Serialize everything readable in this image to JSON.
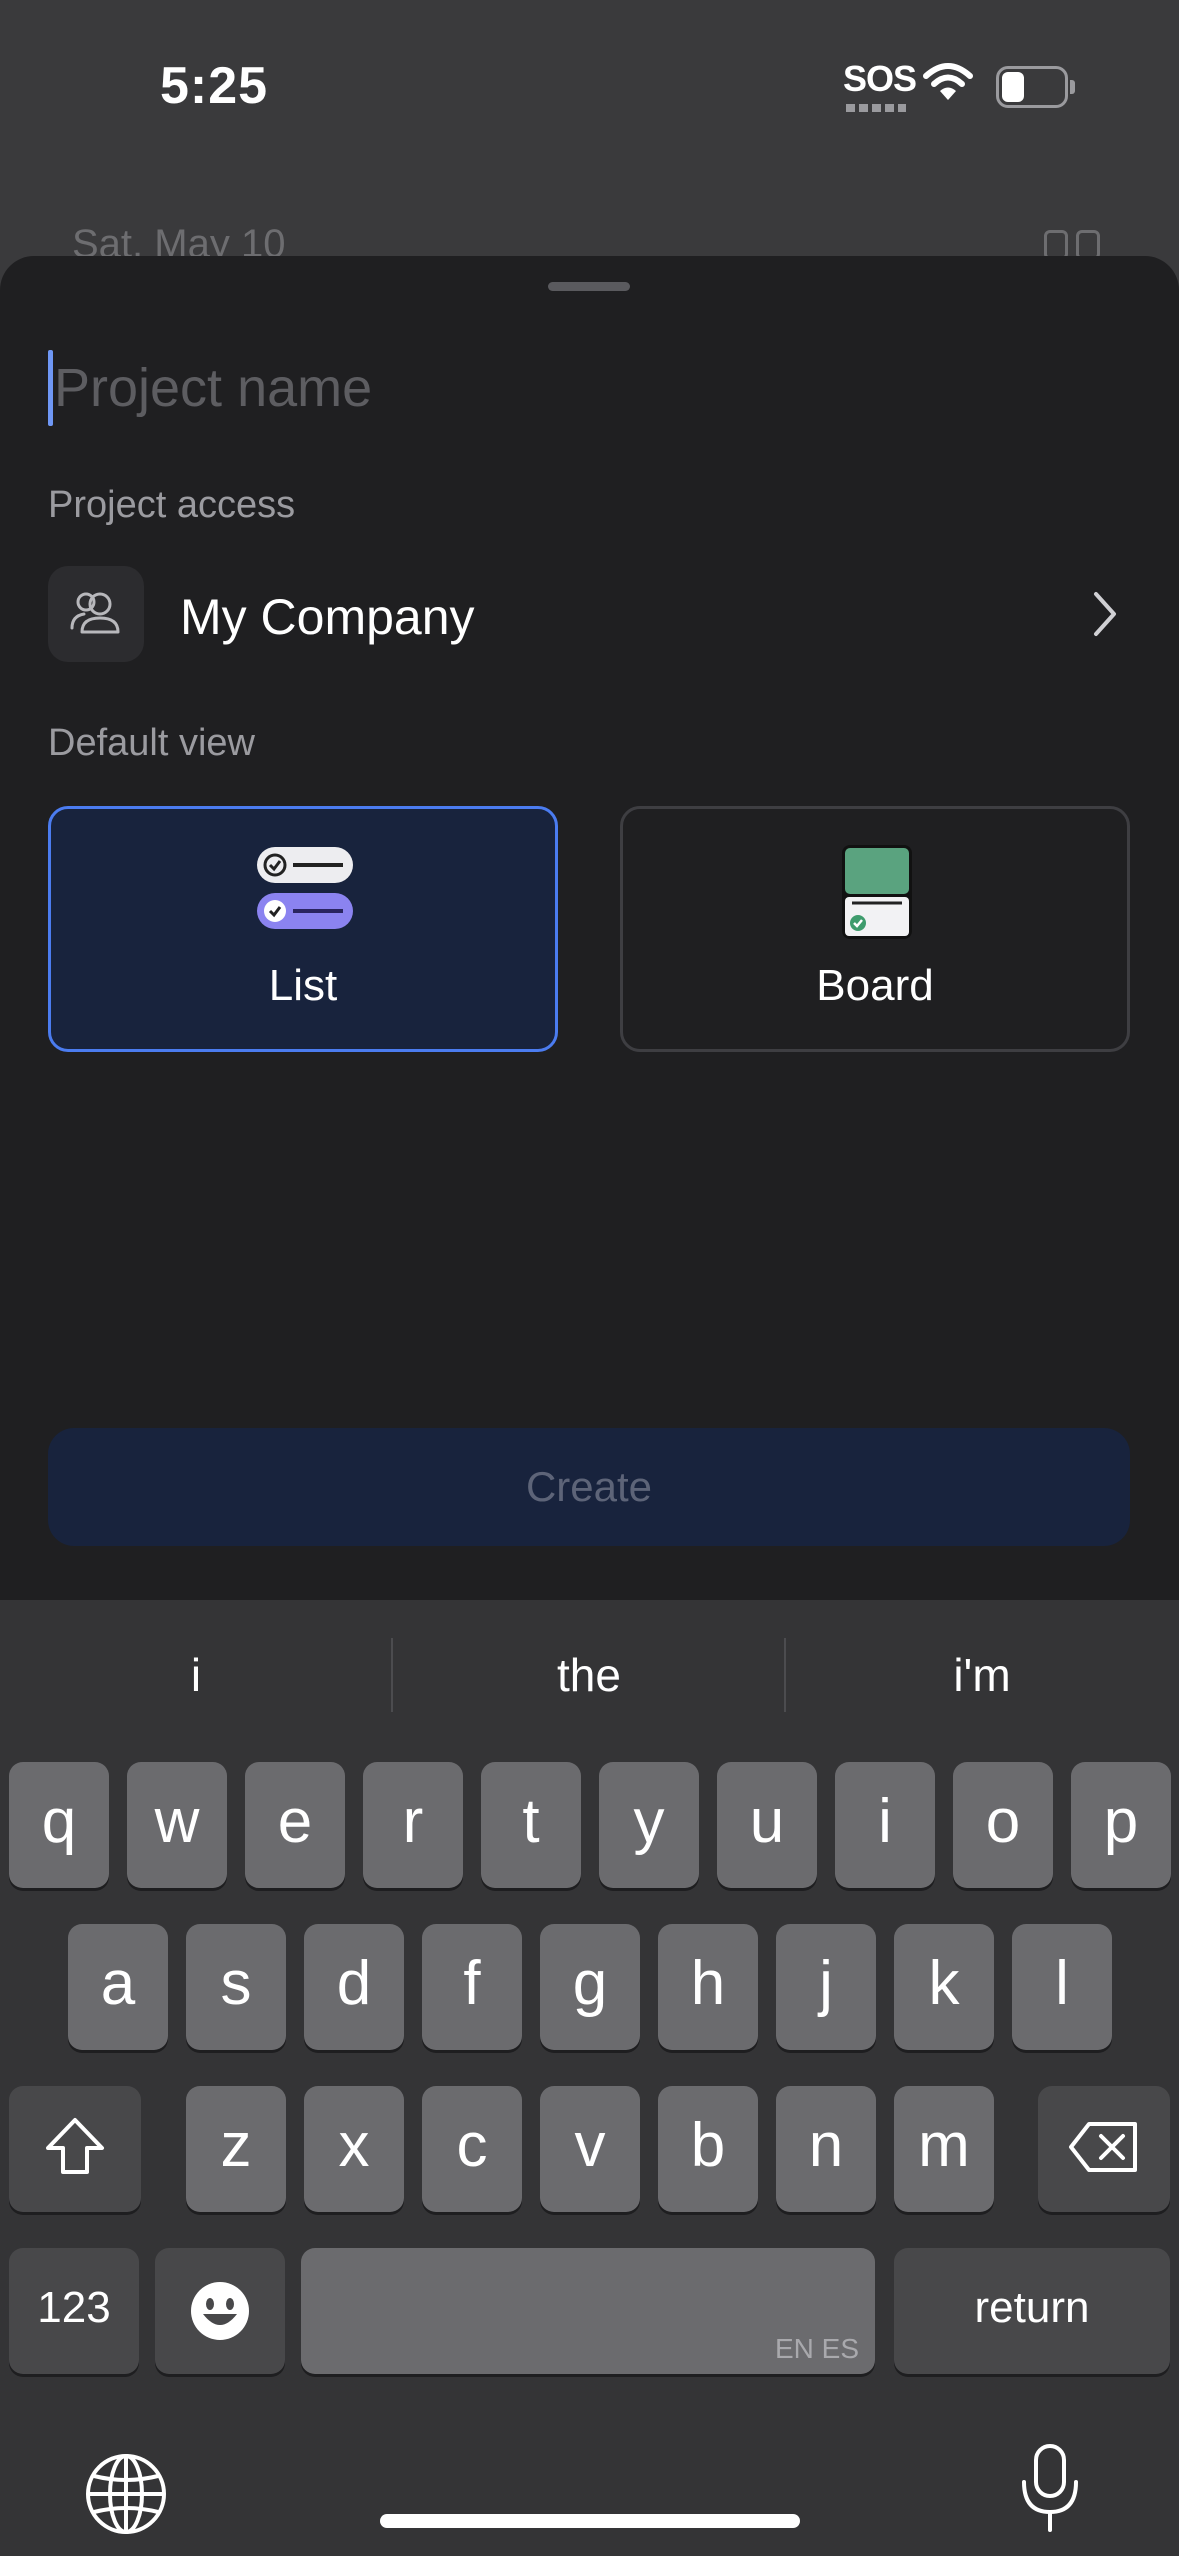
{
  "status_bar": {
    "time": "5:25",
    "carrier": "SOS"
  },
  "backdrop": {
    "date": "Sat, May 10"
  },
  "sheet": {
    "name_placeholder": "Project name",
    "name_value": "",
    "access_label": "Project access",
    "access_value": "My Company",
    "view_label": "Default view",
    "views": [
      {
        "label": "List",
        "selected": true
      },
      {
        "label": "Board",
        "selected": false
      }
    ],
    "create_label": "Create"
  },
  "keyboard": {
    "suggestions": [
      "i",
      "the",
      "i'm"
    ],
    "row1": [
      "q",
      "w",
      "e",
      "r",
      "t",
      "y",
      "u",
      "i",
      "o",
      "p"
    ],
    "row2": [
      "a",
      "s",
      "d",
      "f",
      "g",
      "h",
      "j",
      "k",
      "l"
    ],
    "row3": [
      "z",
      "x",
      "c",
      "v",
      "b",
      "n",
      "m"
    ],
    "numbers_label": "123",
    "return_label": "return",
    "space_lang": "EN ES"
  },
  "colors": {
    "accent": "#4b7cf0",
    "sheet": "#1f1f21",
    "selected_card": "#18233d"
  }
}
